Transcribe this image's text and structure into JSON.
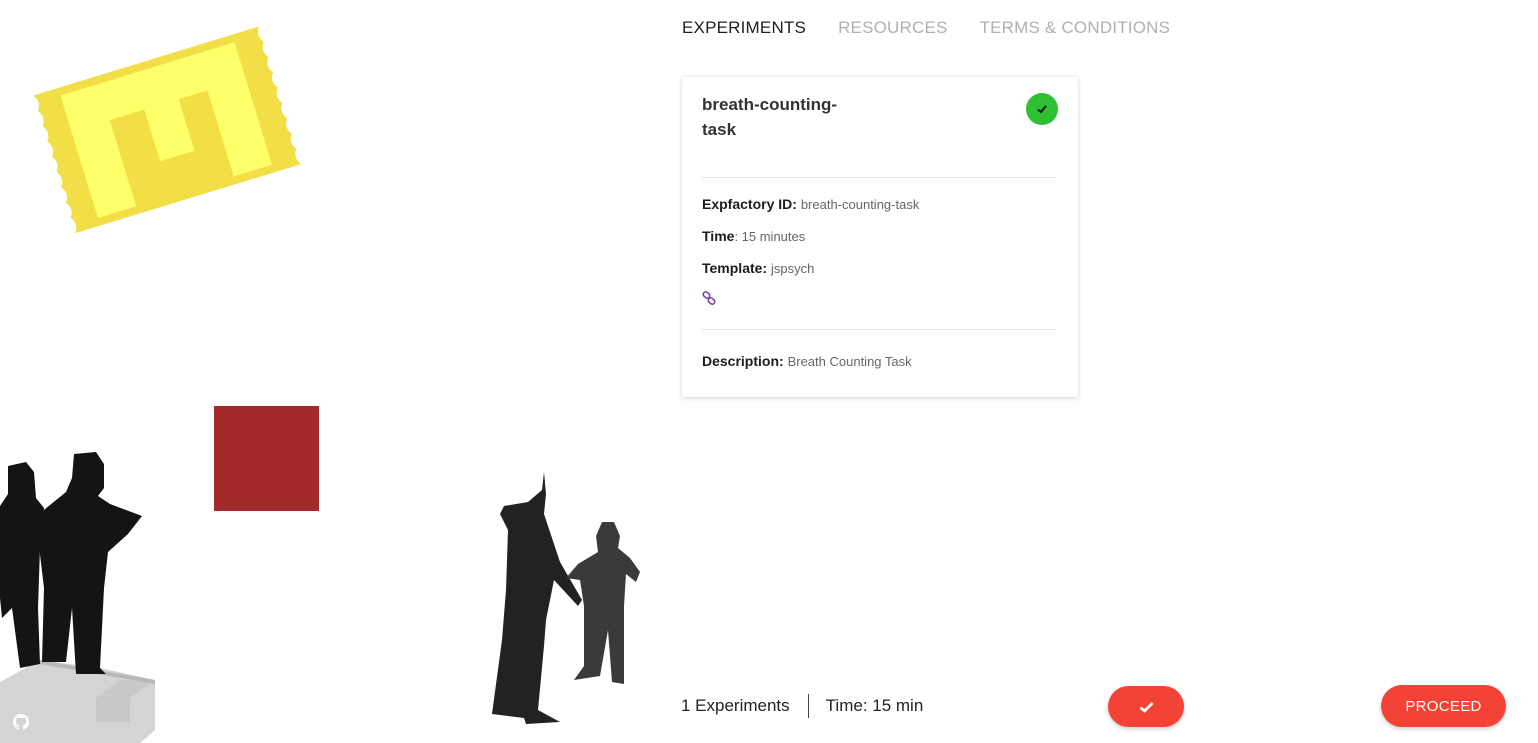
{
  "nav": {
    "tabs": [
      {
        "label": "EXPERIMENTS",
        "active": true
      },
      {
        "label": "RESOURCES",
        "active": false
      },
      {
        "label": "TERMS & CONDITIONS",
        "active": false
      }
    ]
  },
  "experiment_card": {
    "title": "breath-counting-task",
    "status_icon": "check-circle-icon",
    "expfactory_id_label": "Expfactory ID:",
    "expfactory_id": "breath-counting-task",
    "time_label": "Time",
    "time_value": ": 15 minutes",
    "template_label": "Template:",
    "template_value": "jspsych",
    "link_icon": "link-icon",
    "description_label": "Description:",
    "description": "Breath Counting Task"
  },
  "footer": {
    "experiments_count": "1 Experiments",
    "total_time": "Time: 15 min",
    "confirm_icon": "checkmark-icon",
    "proceed_label": "PROCEED"
  },
  "decor": {
    "ticket_logo_color": "#f2df48",
    "ticket_letter_color": "#ffff6a",
    "red_square_color": "#a42a2a",
    "accent_color": "#f44336",
    "status_color": "#2ec033",
    "github_icon": "github-icon"
  }
}
